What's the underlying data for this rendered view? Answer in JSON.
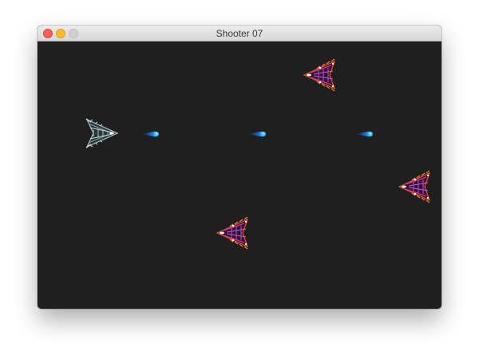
{
  "window": {
    "title": "Shooter 07",
    "controls": [
      {
        "name": "close",
        "color": "#fc5f57"
      },
      {
        "name": "minimize",
        "color": "#fdbc2e"
      },
      {
        "name": "zoom",
        "color": "#d0d0d0"
      }
    ]
  },
  "game": {
    "background_color": "#1f1f1f",
    "player": {
      "icon": "player-spaceship-icon",
      "colors": {
        "hull": "#a9c4c6",
        "outline": "#6e8a8c",
        "accent": "#ffffff"
      }
    },
    "bullets": {
      "icon": "plasma-bullet-icon",
      "count": 3,
      "colors": {
        "core": "#3fc3ff",
        "trail": "#0a4fd6"
      }
    },
    "enemies": {
      "icon": "enemy-spaceship-icon",
      "count": 3,
      "colors": {
        "hull": "#7a1f6e",
        "outline": "#e8552a",
        "accent": "#ffffff"
      }
    }
  }
}
